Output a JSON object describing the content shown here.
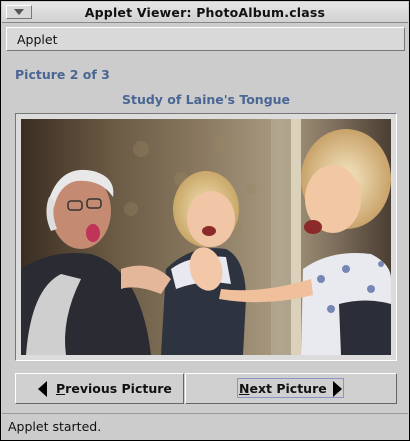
{
  "window": {
    "title": "Applet Viewer: PhotoAlbum.class"
  },
  "menubar": {
    "applet_menu": "Applet"
  },
  "album": {
    "counter": "Picture 2 of 3",
    "picture_title": "Study of Laine's Tongue"
  },
  "buttons": {
    "previous_mnemonic": "P",
    "previous_rest": "revious Picture",
    "next_mnemonic": "N",
    "next_rest": "ext Picture"
  },
  "status": {
    "text": "Applet started."
  },
  "colors": {
    "heading": "#4a6694",
    "background": "#cccccc"
  },
  "icons": {
    "window_menu": "triangle-down-icon",
    "previous": "arrow-left-icon",
    "next": "arrow-right-icon"
  }
}
